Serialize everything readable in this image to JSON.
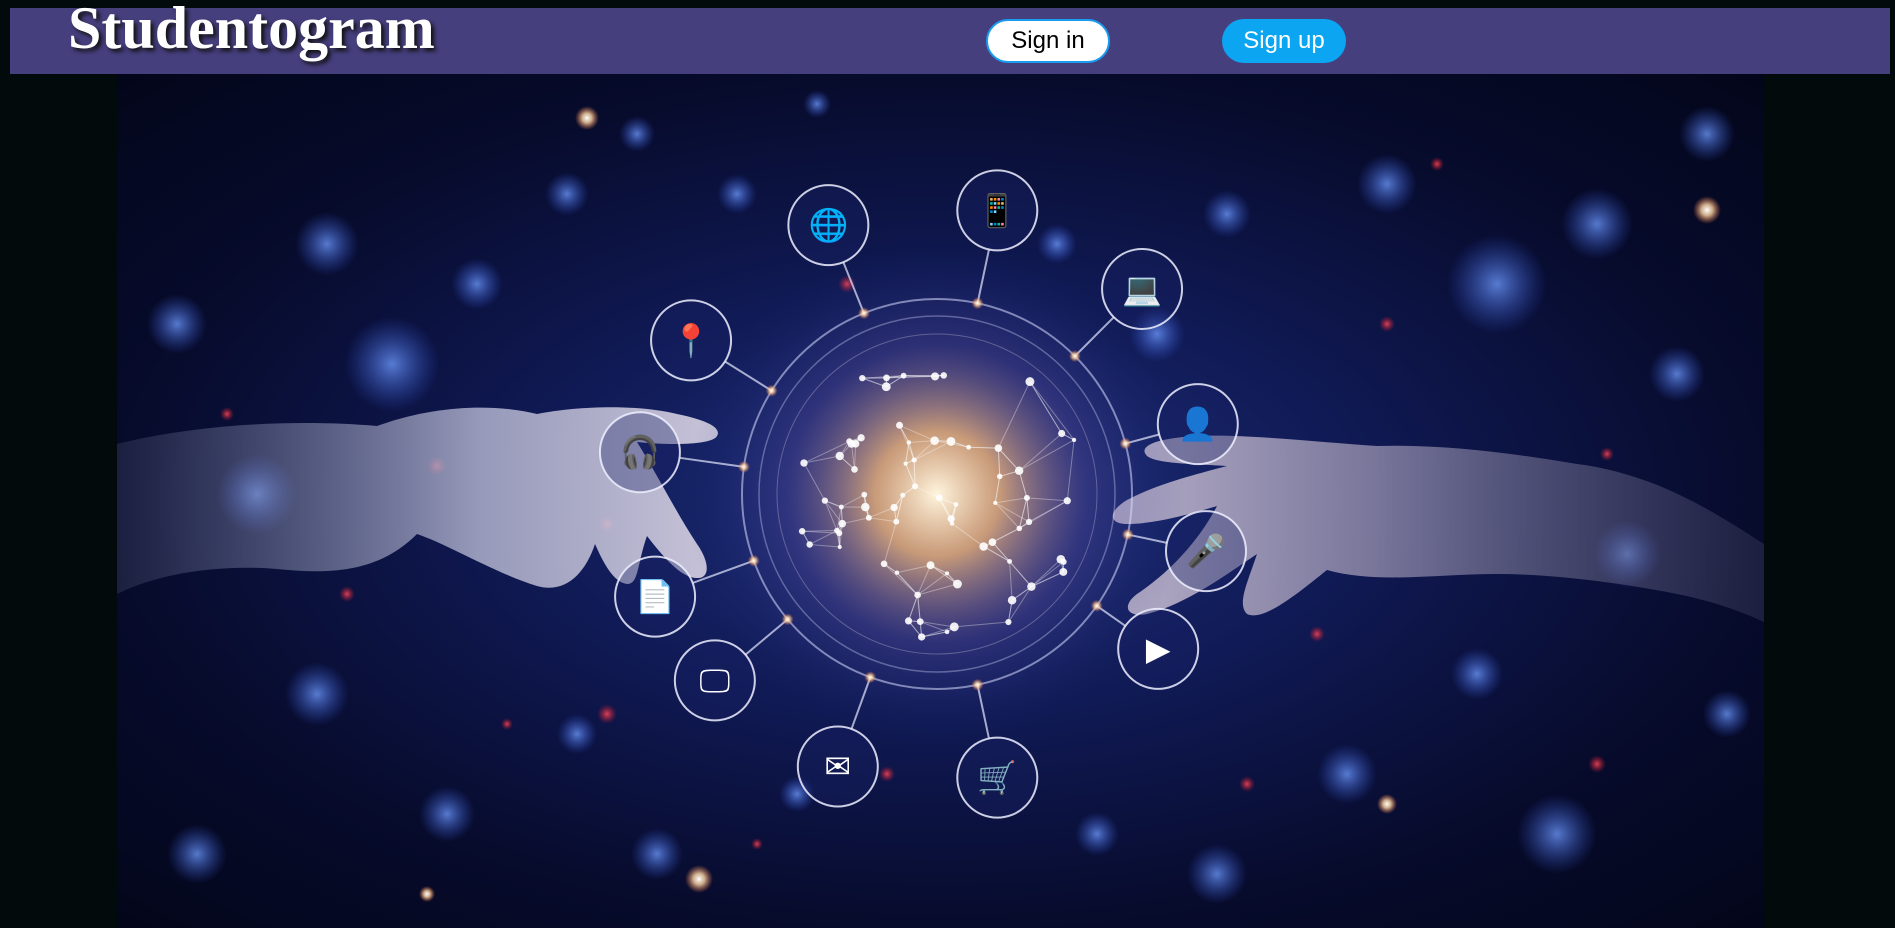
{
  "header": {
    "brand": "Studentogram",
    "sign_in_label": "Sign in",
    "sign_up_label": "Sign up"
  },
  "hero": {
    "icons": [
      "globe-icon",
      "phone-icon",
      "laptop-icon",
      "location-pin-icon",
      "person-icon",
      "headphones-icon",
      "microphone-icon",
      "document-icon",
      "video-play-icon",
      "monitor-icon",
      "mail-icon",
      "shopping-cart-icon"
    ]
  },
  "colors": {
    "navbar": "#463f7e",
    "sign_up": "#0ba5f2",
    "sign_in_border": "#1a9cf0",
    "background": "#020a0c"
  }
}
